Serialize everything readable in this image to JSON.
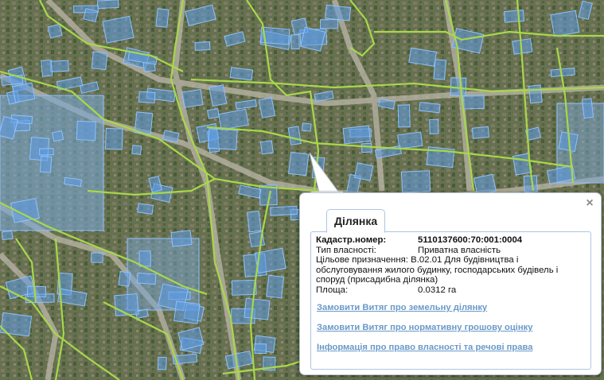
{
  "popup": {
    "tab_label": "Ділянка",
    "close_glyph": "×",
    "fields": {
      "cadastral_label": "Кадастр.номер:",
      "cadastral_value": "5110137600:70:001:0004",
      "ownership_label": "Тип власності:",
      "ownership_value": "Приватна власність",
      "purpose_label": "Цільове призначення:",
      "purpose_value": "В.02.01 Для будівництва і обслуговування жилого будинку, господарських будівель і споруд (присадибна ділянка)",
      "area_label": "Площа:",
      "area_value": "0.0312 га"
    },
    "links": [
      "Замовити Витяг про земельну ділянку",
      "Замовити Витяг про нормативну грошову оцінку",
      "Інформація про право власності та речові права"
    ]
  },
  "colors": {
    "parcel_fill": "#5f9de6",
    "parcel_stroke": "#8ec2ff",
    "boundary": "#a8d84a",
    "link": "#6a99c9"
  },
  "icons": [
    "close-icon"
  ]
}
